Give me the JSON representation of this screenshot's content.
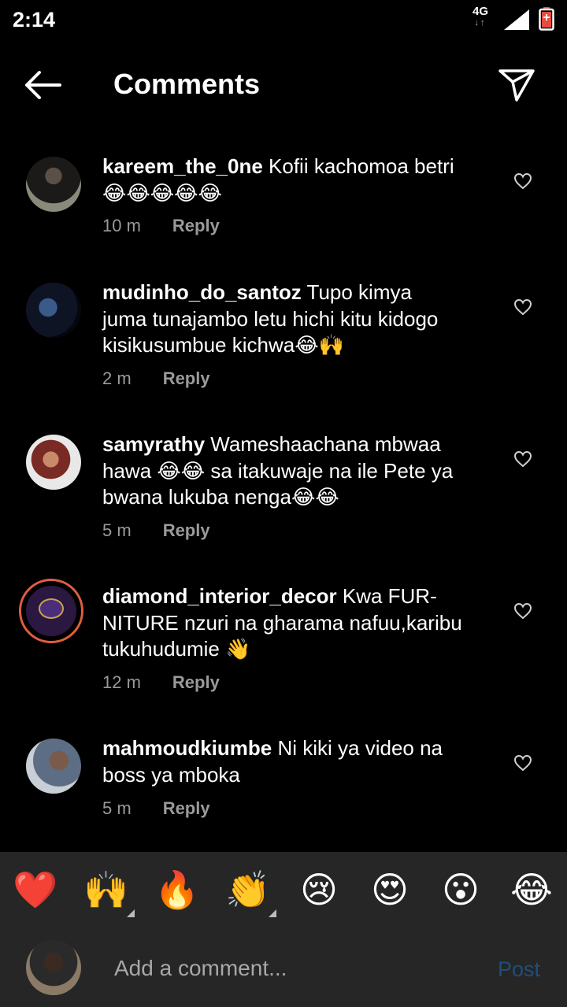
{
  "status": {
    "time": "2:14",
    "network": "4G"
  },
  "header": {
    "title": "Comments"
  },
  "comments": [
    {
      "user": "kareem_the_0ne",
      "text": " Kofii kachomoa betri",
      "line2": "😂😂😂😂😂",
      "time": "10 m",
      "reply": "Reply"
    },
    {
      "user": "mudinho_do_santoz",
      "text": " Tupo kimya",
      "line2": "juma tunajambo letu hichi kitu kidogo",
      "line3": "kisikusumbue kichwa😂🙌",
      "time": "2 m",
      "reply": "Reply"
    },
    {
      "user": "samyrathy",
      "text": " Wameshaachana mbwaa",
      "line2": "hawa 😂😂 sa itakuwaje na ile Pete ya",
      "line3": "bwana lukuba nenga😂😂",
      "time": "5 m",
      "reply": "Reply"
    },
    {
      "user": "diamond_interior_decor",
      "text": " Kwa FUR-",
      "line2": "NITURE nzuri na gharama nafuu,karibu",
      "line3": "tukuhudumie 👋",
      "time": "12 m",
      "reply": "Reply"
    },
    {
      "user": "mahmoudkiumbe",
      "text": " Ni kiki ya video na",
      "line2": "boss ya mboka",
      "time": "5 m",
      "reply": "Reply"
    }
  ],
  "reactions": [
    "❤️",
    "🙌",
    "🔥",
    "👏",
    "😢",
    "😍",
    "😮",
    "😂"
  ],
  "composer": {
    "placeholder": "Add a comment...",
    "post_label": "Post"
  }
}
